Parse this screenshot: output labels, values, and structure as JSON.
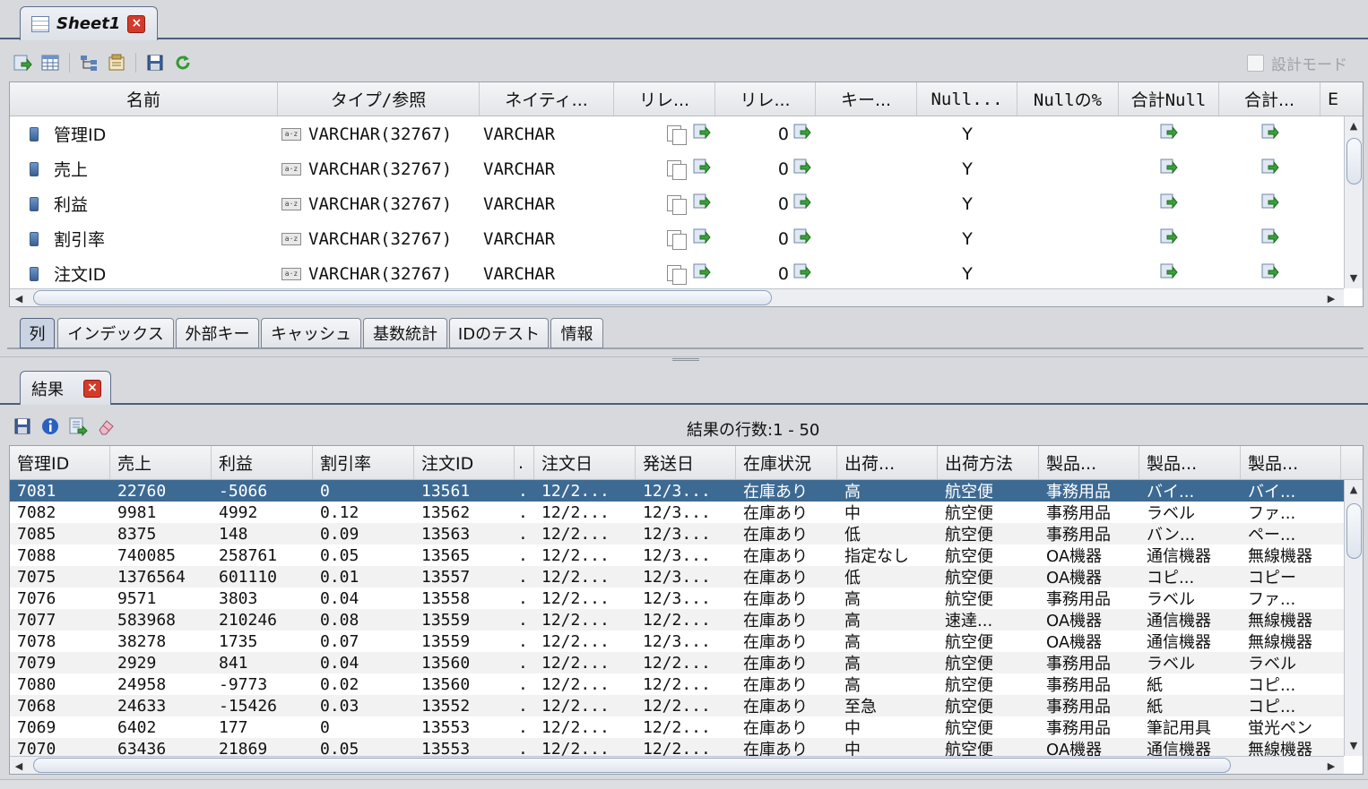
{
  "doc_tab": {
    "title": "Sheet1"
  },
  "design_mode_label": "設計モード",
  "columns_grid": {
    "headers": [
      "名前",
      "タイプ/参照",
      "ネイティ...",
      "リレ...",
      "リレ...",
      "キー...",
      "Null...",
      "Nullの%",
      "合計Null",
      "合計...",
      "E"
    ],
    "rows": [
      {
        "name": "管理ID",
        "type": "VARCHAR(32767)",
        "native": "VARCHAR",
        "rel_count": "0",
        "nullable": "Y"
      },
      {
        "name": "売上",
        "type": "VARCHAR(32767)",
        "native": "VARCHAR",
        "rel_count": "0",
        "nullable": "Y"
      },
      {
        "name": "利益",
        "type": "VARCHAR(32767)",
        "native": "VARCHAR",
        "rel_count": "0",
        "nullable": "Y"
      },
      {
        "name": "割引率",
        "type": "VARCHAR(32767)",
        "native": "VARCHAR",
        "rel_count": "0",
        "nullable": "Y"
      },
      {
        "name": "注文ID",
        "type": "VARCHAR(32767)",
        "native": "VARCHAR",
        "rel_count": "0",
        "nullable": "Y"
      }
    ]
  },
  "detail_tabs": [
    "列",
    "インデックス",
    "外部キー",
    "キャッシュ",
    "基数統計",
    "IDのテスト",
    "情報"
  ],
  "results_tab": {
    "title": "結果"
  },
  "results_count": "結果の行数:1 - 50",
  "results_grid": {
    "headers": [
      "管理ID",
      "売上",
      "利益",
      "割引率",
      "注文ID",
      ".",
      "注文日",
      "発送日",
      "在庫状況",
      "出荷...",
      "出荷方法",
      "製品...",
      "製品...",
      "製品..."
    ],
    "rows": [
      [
        "7081",
        "22760",
        "-5066",
        "0",
        "13561",
        ".",
        "12/2...",
        "12/3...",
        "在庫あり",
        "高",
        "航空便",
        "事務用品",
        "バイ...",
        "バイ..."
      ],
      [
        "7082",
        "9981",
        "4992",
        "0.12",
        "13562",
        ".",
        "12/2...",
        "12/3...",
        "在庫あり",
        "中",
        "航空便",
        "事務用品",
        "ラベル",
        "ファ..."
      ],
      [
        "7085",
        "8375",
        "148",
        "0.09",
        "13563",
        ".",
        "12/2...",
        "12/3...",
        "在庫あり",
        "低",
        "航空便",
        "事務用品",
        "バン...",
        "ペー..."
      ],
      [
        "7088",
        "740085",
        "258761",
        "0.05",
        "13565",
        ".",
        "12/2...",
        "12/3...",
        "在庫あり",
        "指定なし",
        "航空便",
        "OA機器",
        "通信機器",
        "無線機器"
      ],
      [
        "7075",
        "1376564",
        "601110",
        "0.01",
        "13557",
        ".",
        "12/2...",
        "12/3...",
        "在庫あり",
        "低",
        "航空便",
        "OA機器",
        "コピ...",
        "コピー"
      ],
      [
        "7076",
        "9571",
        "3803",
        "0.04",
        "13558",
        ".",
        "12/2...",
        "12/3...",
        "在庫あり",
        "高",
        "航空便",
        "事務用品",
        "ラベル",
        "ファ..."
      ],
      [
        "7077",
        "583968",
        "210246",
        "0.08",
        "13559",
        ".",
        "12/2...",
        "12/2...",
        "在庫あり",
        "高",
        "速達...",
        "OA機器",
        "通信機器",
        "無線機器"
      ],
      [
        "7078",
        "38278",
        "1735",
        "0.07",
        "13559",
        ".",
        "12/2...",
        "12/3...",
        "在庫あり",
        "高",
        "航空便",
        "OA機器",
        "通信機器",
        "無線機器"
      ],
      [
        "7079",
        "2929",
        "841",
        "0.04",
        "13560",
        ".",
        "12/2...",
        "12/2...",
        "在庫あり",
        "高",
        "航空便",
        "事務用品",
        "ラベル",
        "ラベル"
      ],
      [
        "7080",
        "24958",
        "-9773",
        "0.02",
        "13560",
        ".",
        "12/2...",
        "12/2...",
        "在庫あり",
        "高",
        "航空便",
        "事務用品",
        "紙",
        "コピ..."
      ],
      [
        "7068",
        "24633",
        "-15426",
        "0.03",
        "13552",
        ".",
        "12/2...",
        "12/2...",
        "在庫あり",
        "至急",
        "航空便",
        "事務用品",
        "紙",
        "コピ..."
      ],
      [
        "7069",
        "6402",
        "177",
        "0",
        "13553",
        ".",
        "12/2...",
        "12/2...",
        "在庫あり",
        "中",
        "航空便",
        "事務用品",
        "筆記用具",
        "蛍光ペン"
      ],
      [
        "7070",
        "63436",
        "21869",
        "0.05",
        "13553",
        ".",
        "12/2...",
        "12/2...",
        "在庫あり",
        "中",
        "航空便",
        "OA機器",
        "通信機器",
        "無線機器"
      ]
    ]
  }
}
